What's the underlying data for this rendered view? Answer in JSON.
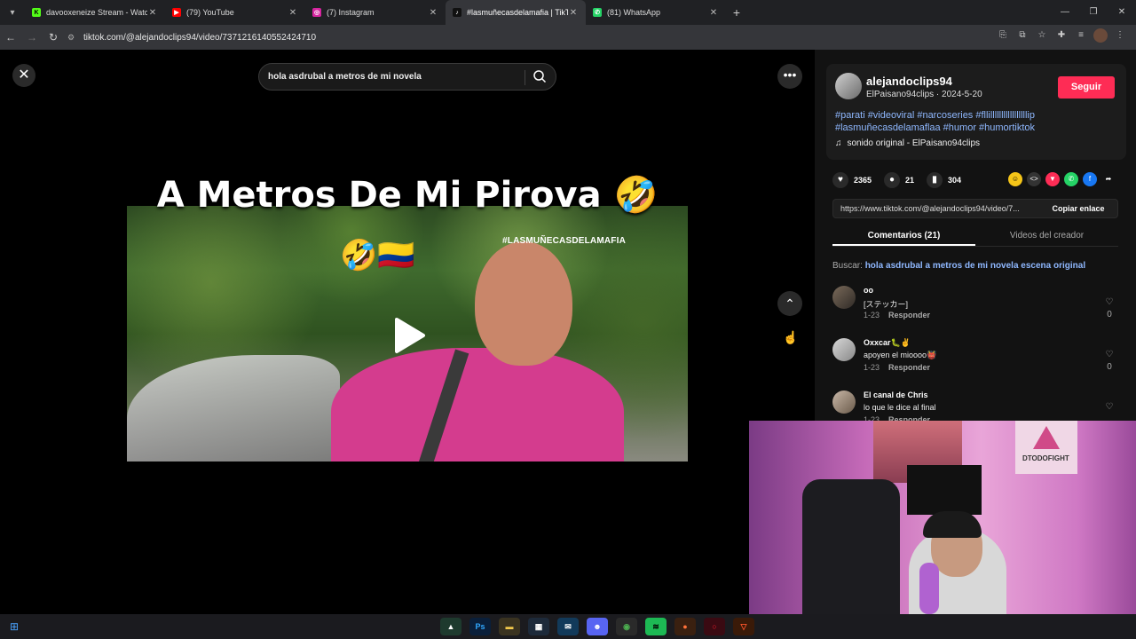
{
  "browser": {
    "tabs": [
      {
        "title": "davooxeneize Stream - Watch L",
        "icon": "kick-icon",
        "color": "#53fc18",
        "active": false
      },
      {
        "title": "(79) YouTube",
        "icon": "youtube-icon",
        "color": "#ff0000",
        "active": false
      },
      {
        "title": "(7) Instagram",
        "icon": "instagram-icon",
        "color": "#d6249f",
        "active": false
      },
      {
        "title": "#lasmuñecasdelamafia | TikTok",
        "icon": "tiktok-icon",
        "color": "#111111",
        "active": true
      },
      {
        "title": "(81) WhatsApp",
        "icon": "whatsapp-icon",
        "color": "#25d366",
        "active": false
      }
    ],
    "url": "tiktok.com/@alejandoclips94/video/7371216140552424710"
  },
  "video": {
    "search_query": "hola asdrubal a metros de mi novela",
    "caption": "A Metros De Mi Pirova 🤣",
    "caption_emoji_line": "🤣🇨🇴",
    "watermark": "#LASMUÑECASDELAMAFIA"
  },
  "creator": {
    "username": "alejandoclips94",
    "subline": "ElPaisano94clips · 2024-5-20",
    "follow_label": "Seguir",
    "description": "#parati #videoviral #narcoseries #fllilllllllllllllllllip #lasmuñecasdelamaflaa #humor #humortiktok",
    "sound": "sonido original - ElPaisano94clips"
  },
  "stats": {
    "likes": "2365",
    "comments": "21",
    "saves": "304"
  },
  "share": {
    "link": "https://www.tiktok.com/@alejandoclips94/video/7...",
    "copy_label": "Copiar enlace"
  },
  "panel_tabs": {
    "comments": "Comentarios (21)",
    "creator_videos": "Videos del creador"
  },
  "related_search": {
    "label": "Buscar:",
    "query": "hola asdrubal a metros de mi novela escena original"
  },
  "comments": [
    {
      "user": "oo",
      "text": "[ステッカー]",
      "date": "1-23",
      "reply": "Responder",
      "likes": "0"
    },
    {
      "user": "Oxxcar🐛✌",
      "text": "apoyen el mioooo👹",
      "date": "1-23",
      "reply": "Responder",
      "likes": "0"
    },
    {
      "user": "El canal de Chris",
      "text": "lo que le dice al final",
      "date": "1-23",
      "reply": "Responder",
      "likes": ""
    }
  ],
  "webcam": {
    "poster_text": "DTODOFIGHT"
  },
  "taskbar": {
    "apps": [
      "Ps"
    ]
  }
}
